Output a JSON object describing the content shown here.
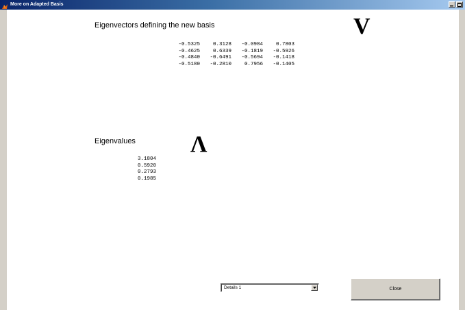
{
  "window": {
    "title": "More on Adapted Basis",
    "title_icon": "matlab-icon",
    "controls": [
      "minimize-icon",
      "maximize-icon"
    ]
  },
  "eigenvectors": {
    "heading": "Eigenvectors defining the new basis",
    "symbol": "V",
    "rows": [
      [
        "-0.5325",
        "0.3128",
        "-0.0984",
        "0.7803"
      ],
      [
        "-0.4625",
        "0.6339",
        "-0.1819",
        "-0.5926"
      ],
      [
        "-0.4840",
        "-0.6491",
        "-0.5694",
        "-0.1418"
      ],
      [
        "-0.5180",
        "-0.2810",
        "0.7956",
        "-0.1405"
      ]
    ]
  },
  "eigenvalues": {
    "heading": "Eigenvalues",
    "symbol": "Λ",
    "values": [
      "3.1804",
      "0.5920",
      "0.2793",
      "0.1985"
    ]
  },
  "controls": {
    "dropdown_selected": "Details 1",
    "close_label": "Close"
  },
  "colors": {
    "titlebar_start": "#0a246a",
    "titlebar_end": "#a6caf0",
    "window_bg": "#d4d0c8",
    "client_bg": "#ffffff"
  }
}
